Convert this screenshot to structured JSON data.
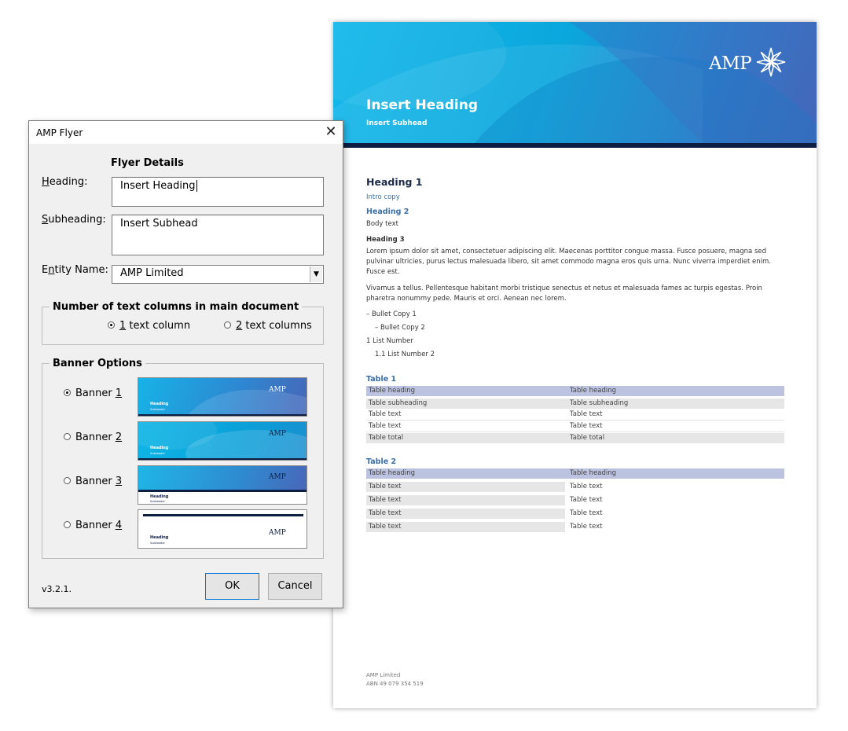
{
  "document": {
    "banner_heading": "Insert Heading",
    "banner_subhead": "Insert Subhead",
    "logo_text": "AMP",
    "heading1": "Heading 1",
    "intro": "Intro copy",
    "heading2": "Heading 2",
    "body_text": "Body text",
    "heading3": "Heading 3",
    "paragraph1": "Lorem ipsum dolor sit amet, consectetuer adipiscing elit. Maecenas porttitor congue massa. Fusce posuere, magna sed pulvinar ultricies, purus lectus malesuada libero, sit amet commodo magna eros quis urna. Nunc viverra imperdiet enim. Fusce est.",
    "paragraph2": "Vivamus a tellus. Pellentesque habitant morbi tristique senectus et netus et malesuada fames ac turpis egestas. Proin pharetra nonummy pede. Mauris et orci. Aenean nec lorem.",
    "bullet1": "–   Bullet Copy 1",
    "bullet2": "–   Bullet Copy 2",
    "list1": "1    List Number",
    "list2": "1.1      List Number 2",
    "table1": {
      "title": "Table 1",
      "header": [
        "Table heading",
        "Table heading"
      ],
      "subheader": [
        "Table subheading",
        "Table subheading"
      ],
      "rows": [
        [
          "Table text",
          "Table text"
        ],
        [
          "Table text",
          "Table text"
        ]
      ],
      "total": [
        "Table total",
        "Table total"
      ]
    },
    "table2": {
      "title": "Table 2",
      "header": [
        "Table heading",
        "Table heading"
      ],
      "rows": [
        [
          "Table text",
          "Table text"
        ],
        [
          "Table text",
          "Table text"
        ],
        [
          "Table text",
          "Table text"
        ],
        [
          "Table text",
          "Table text"
        ]
      ]
    },
    "footer_line1": "AMP Limited",
    "footer_line2": "ABN 49 079 354 519"
  },
  "dialog": {
    "title": "AMP Flyer",
    "close_glyph": "✕",
    "section_title": "Flyer Details",
    "heading_label": "eading:",
    "heading_label_accel": "H",
    "heading_value": "Insert Heading",
    "subheading_label": "ubheading:",
    "subheading_label_accel": "S",
    "subheading_value": "Insert Subhead",
    "entity_label_pre": "E",
    "entity_label_accel": "n",
    "entity_label_post": "tity Name:",
    "entity_value": "AMP Limited",
    "dropdown_glyph": "▼",
    "columns_group": "Number of text columns in main document",
    "column_option1_accel": "1",
    "column_option1_rest": " text column",
    "column_option2_accel": "2",
    "column_option2_rest": " text columns",
    "selected_columns": 1,
    "banner_group": "Banner Options",
    "banner_label": "Banner ",
    "banner_numbers": [
      "1",
      "2",
      "3",
      "4"
    ],
    "selected_banner": 1,
    "thumb_heading": "Heading",
    "thumb_sub": "Subheader",
    "thumb_logo": "AMP",
    "version": "v3.2.1.",
    "ok_label": "OK",
    "cancel_label": "Cancel"
  },
  "colors": {
    "banner_start": "#14b8ea",
    "banner_end": "#4a63b5",
    "navy": "#0e1e42",
    "accent_blue": "#3a6fa8",
    "table_header": "#bcc3e0"
  }
}
